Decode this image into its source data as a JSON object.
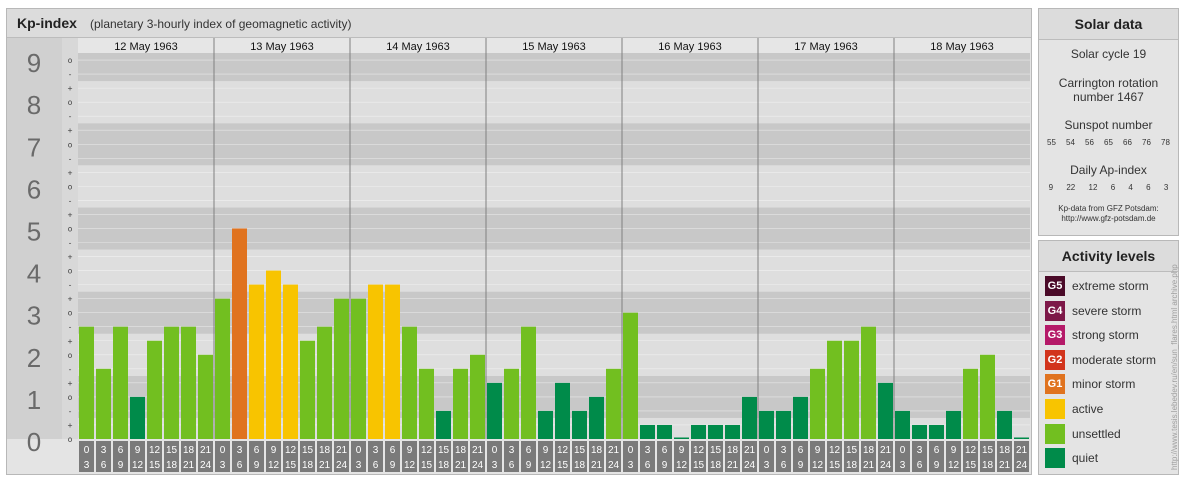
{
  "header": {
    "title": "Kp-index",
    "subtitle": "(planetary 3-hourly index of geomagnetic activity)"
  },
  "chart_data": {
    "type": "bar",
    "title": "Kp-index",
    "subtitle": "(planetary 3-hourly index of geomagnetic activity)",
    "ylim": [
      0,
      9
    ],
    "y_ticks": [
      "0",
      "1",
      "2",
      "3",
      "4",
      "5",
      "6",
      "7",
      "8",
      "9"
    ],
    "y_subticks": [
      "o",
      "+",
      "-"
    ],
    "days": [
      "12 May 1963",
      "13 May 1963",
      "14 May 1963",
      "15 May 1963",
      "16 May 1963",
      "17 May 1963",
      "18 May 1963"
    ],
    "interval_start_labels": [
      "0",
      "3",
      "6",
      "9",
      "12",
      "15",
      "18",
      "21"
    ],
    "interval_end_labels": [
      "3",
      "6",
      "9",
      "12",
      "15",
      "18",
      "21",
      "24"
    ],
    "values": [
      [
        2.667,
        1.667,
        2.667,
        1.0,
        2.333,
        2.667,
        2.667,
        2.0
      ],
      [
        3.333,
        5.0,
        3.667,
        4.0,
        3.667,
        2.333,
        2.667,
        3.333
      ],
      [
        3.333,
        3.667,
        3.667,
        2.667,
        1.667,
        0.667,
        1.667,
        2.0
      ],
      [
        1.333,
        1.667,
        2.667,
        0.667,
        1.333,
        0.667,
        1.0,
        1.667
      ],
      [
        3.0,
        0.333,
        0.333,
        0.0,
        0.333,
        0.333,
        0.333,
        1.0
      ],
      [
        0.667,
        0.667,
        1.0,
        1.667,
        2.333,
        2.333,
        2.667,
        1.333
      ],
      [
        0.667,
        0.333,
        0.333,
        0.667,
        1.667,
        2.0,
        0.667,
        0.0
      ]
    ],
    "level_colors": {
      "quiet": "#008b4a",
      "unsettled": "#72bf20",
      "active": "#f8c400",
      "G1": "#e0731f",
      "G2": "#d2341c",
      "G3": "#b51a69",
      "G4": "#7d1848",
      "G5": "#4a0a28"
    }
  },
  "solar_data": {
    "heading": "Solar data",
    "solar_cycle": "Solar cycle 19",
    "carrington_line1": "Carrington rotation",
    "carrington_line2": "number 1467",
    "sunspot_label": "Sunspot number",
    "sunspot_numbers": [
      "55",
      "54",
      "56",
      "65",
      "66",
      "76",
      "78"
    ],
    "ap_label": "Daily Ap-index",
    "ap_values": [
      "9",
      "22",
      "12",
      "6",
      "4",
      "6",
      "3"
    ],
    "credit_line1": "Kp-data from GFZ Potsdam:",
    "credit_line2": "http://www.gfz-potsdam.de"
  },
  "activity_levels": {
    "heading": "Activity levels",
    "items": [
      {
        "badge": "G5",
        "label": "extreme storm",
        "color": "#4a0a28"
      },
      {
        "badge": "G4",
        "label": "severe storm",
        "color": "#7d1848"
      },
      {
        "badge": "G3",
        "label": "strong storm",
        "color": "#b51a69"
      },
      {
        "badge": "G2",
        "label": "moderate storm",
        "color": "#d2341c"
      },
      {
        "badge": "G1",
        "label": "minor storm",
        "color": "#e0731f"
      },
      {
        "badge": "",
        "label": "active",
        "color": "#f8c400"
      },
      {
        "badge": "",
        "label": "unsettled",
        "color": "#72bf20"
      },
      {
        "badge": "",
        "label": "quiet",
        "color": "#008b4a"
      }
    ]
  },
  "watermark": "http://www.tesis.lebedev.ru/en/sun_flares.html  archive.php"
}
